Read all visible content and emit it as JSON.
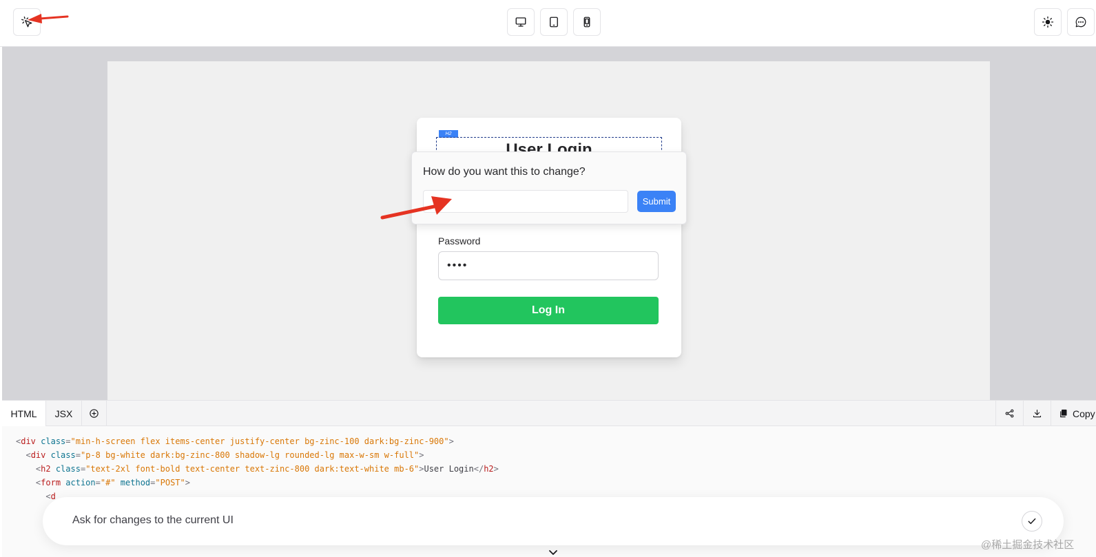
{
  "toolbar": {
    "select_icon": "cursor-select-icon",
    "viewports": [
      "desktop-icon",
      "tablet-icon",
      "mobile-icon"
    ],
    "theme_icon": "sun-icon",
    "chat_icon": "chat-bubble-icon"
  },
  "preview": {
    "h2_tag": "H2",
    "title": "User Login",
    "password_label": "Password",
    "password_value": "••••",
    "login_button": "Log In"
  },
  "popover": {
    "question": "How do you want this to change?",
    "input_value": "",
    "submit_label": "Submit"
  },
  "code_panel": {
    "tabs": [
      "HTML",
      "JSX"
    ],
    "copy_label": "Copy"
  },
  "ask": {
    "placeholder": "Ask for changes to the current UI"
  },
  "watermark": "@稀土掘金技术社区",
  "colors": {
    "accent_blue": "#3b82f6",
    "login_green": "#22c55e",
    "annotation_red": "#e53322"
  }
}
